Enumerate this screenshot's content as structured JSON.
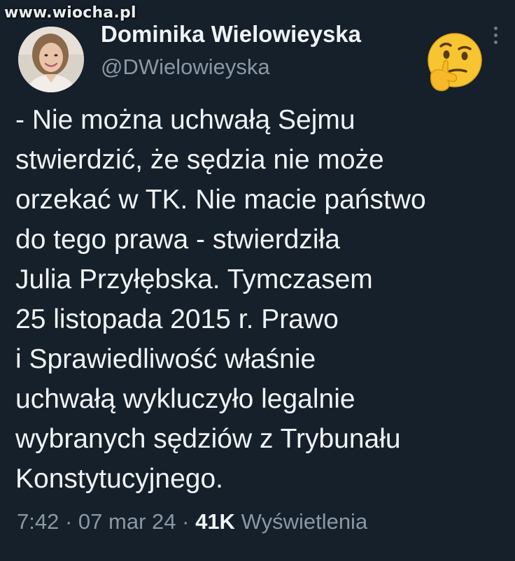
{
  "watermark": "www.wiocha.pl",
  "author": {
    "display_name": "Dominika Wielowieyska",
    "handle": "@DWielowieyska",
    "avatar_icon": "profile-photo"
  },
  "reaction_emoji": "thinking-face-icon",
  "tweet": {
    "lines": [
      "- Nie można uchwałą Sejmu",
      "stwierdzić, że sędzia nie może",
      "orzekać w TK. Nie macie państwo",
      "do tego prawa - stwierdziła",
      "Julia Przyłębska. Tymczasem",
      "25 listopada 2015 r. Prawo",
      "i Sprawiedliwość właśnie",
      "uchwałą wykluczyło legalnie",
      "wybranych sędziów z Trybunału",
      "Konstytucyjnego."
    ]
  },
  "meta": {
    "time": "7:42",
    "separator": "·",
    "date": "07 mar 24",
    "views_count": "41K",
    "views_label": "Wyświetlenia"
  },
  "colors": {
    "background": "#15202b",
    "text_primary": "#f1f4f6",
    "text_secondary": "#8a98a5"
  }
}
